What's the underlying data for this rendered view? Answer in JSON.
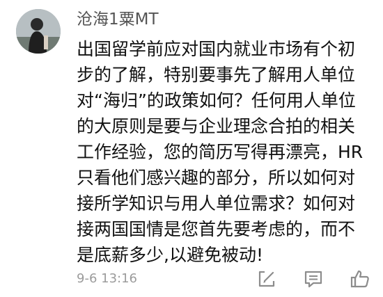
{
  "comment": {
    "username": "沧海1粟MT",
    "lines": [
      "出国留学前应对国内就业市场有个初",
      "步的了解，特别要事先了解用人单位",
      "对“海归”的政策如何？任何用人单位",
      "的大原则是要与企业理念合拍的相关",
      "工作经验，您的简历写得再漂亮，HR",
      "只看他们感兴趣的部分，所以如何对",
      "接所学知识与用人单位需求？如何对",
      "接两国国情是您首先要考虑的，而不",
      "是底薪多少,以避免被动!"
    ],
    "timestamp": "9-6 13:16"
  },
  "actions": [
    {
      "icon": "edit-icon"
    },
    {
      "icon": "comment-icon"
    },
    {
      "icon": "like-icon"
    }
  ],
  "colors": {
    "username": "#555555",
    "text": "#111111",
    "timestamp": "#9b9b9b",
    "icon": "#8c8c8c"
  }
}
